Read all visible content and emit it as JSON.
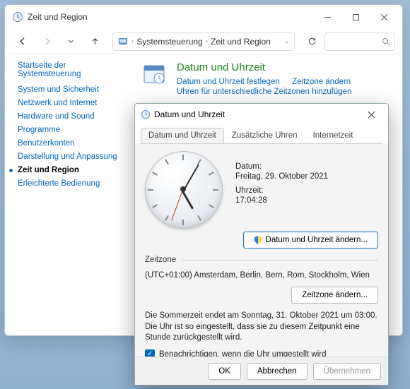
{
  "window": {
    "title": "Zeit und Region",
    "breadcrumb": {
      "root": "Systemsteuerung",
      "current": "Zeit und Region"
    }
  },
  "sidebar": {
    "heading": "Startseite der Systemsteuerung",
    "items": [
      {
        "label": "System und Sicherheit"
      },
      {
        "label": "Netzwerk und Internet"
      },
      {
        "label": "Hardware und Sound"
      },
      {
        "label": "Programme"
      },
      {
        "label": "Benutzerkonten"
      },
      {
        "label": "Darstellung und Anpassung"
      },
      {
        "label": "Zeit und Region"
      },
      {
        "label": "Erleichterte Bedienung"
      }
    ],
    "active_index": 6
  },
  "main": {
    "category_title": "Datum und Uhrzeit",
    "links": [
      "Datum und Uhrzeit festlegen",
      "Zeitzone ändern",
      "Uhren für unterschiedliche Zeitzonen hinzufügen"
    ]
  },
  "dialog": {
    "title": "Datum und Uhrzeit",
    "tabs": [
      "Datum und Uhrzeit",
      "Zusätzliche Uhren",
      "Internetzeit"
    ],
    "active_tab": 0,
    "date_label": "Datum:",
    "date_value": "Freitag, 29. Oktober 2021",
    "time_label": "Uhrzeit:",
    "time_value": "17:04:28",
    "change_dt_btn": "Datum und Uhrzeit ändern...",
    "tz_heading": "Zeitzone",
    "tz_value": "(UTC+01:00) Amsterdam, Berlin, Bern, Rom, Stockholm, Wien",
    "change_tz_btn": "Zeitzone ändern...",
    "dst_text": "Die Sommerzeit endet am Sonntag, 31. Oktober 2021 um 03:00. Die Uhr ist so eingestellt, dass sie zu diesem Zeitpunkt eine Stunde zurückgestellt wird.",
    "notify_checked": true,
    "notify_label": "Benachrichtigen, wenn die Uhr umgestellt wird",
    "buttons": {
      "ok": "OK",
      "cancel": "Abbrechen",
      "apply": "Übernehmen"
    }
  }
}
